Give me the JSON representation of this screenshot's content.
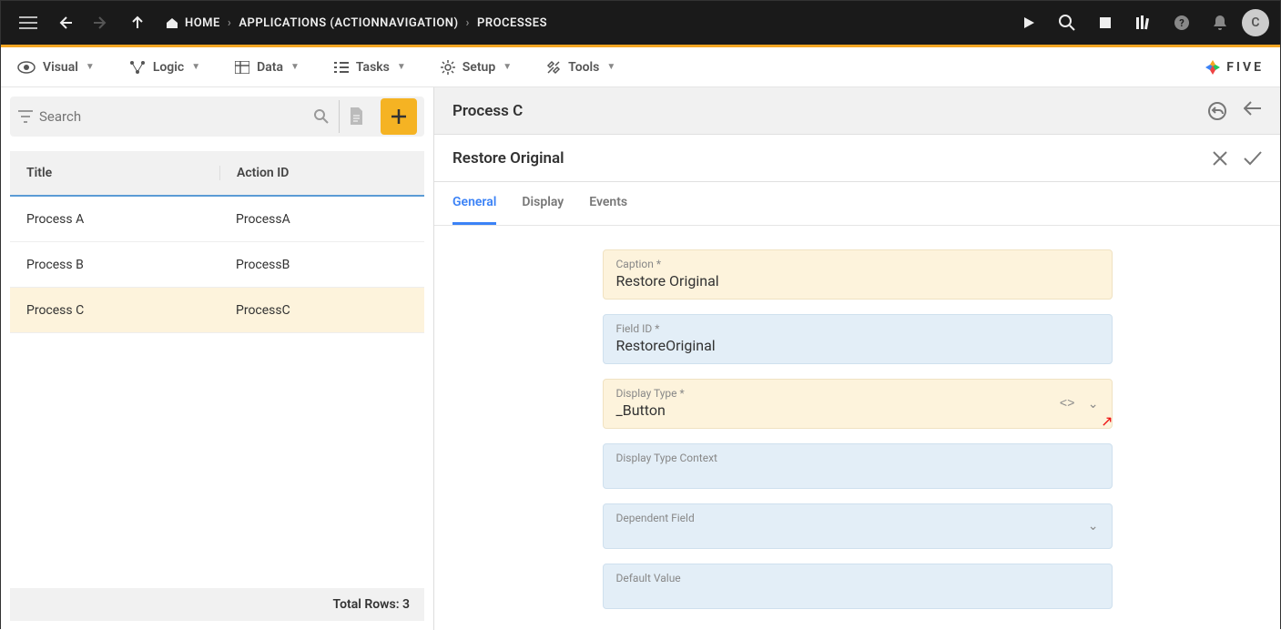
{
  "topbar": {
    "breadcrumb": [
      "HOME",
      "APPLICATIONS (ACTIONNAVIGATION)",
      "PROCESSES"
    ],
    "avatar_initial": "C"
  },
  "menubar": {
    "items": [
      "Visual",
      "Logic",
      "Data",
      "Tasks",
      "Setup",
      "Tools"
    ],
    "brand": "FIVE"
  },
  "left": {
    "search_placeholder": "Search",
    "columns": [
      "Title",
      "Action ID"
    ],
    "rows": [
      {
        "title": "Process A",
        "action_id": "ProcessA",
        "selected": false
      },
      {
        "title": "Process B",
        "action_id": "ProcessB",
        "selected": false
      },
      {
        "title": "Process C",
        "action_id": "ProcessC",
        "selected": true
      }
    ],
    "footer": "Total Rows: 3"
  },
  "right": {
    "crumb_title": "Process C",
    "sub_title": "Restore Original",
    "tabs": [
      "General",
      "Display",
      "Events"
    ],
    "active_tab": 0,
    "fields": {
      "caption": {
        "label": "Caption *",
        "value": "Restore Original"
      },
      "field_id": {
        "label": "Field ID *",
        "value": "RestoreOriginal"
      },
      "display_type": {
        "label": "Display Type *",
        "value": "_Button"
      },
      "display_type_context": {
        "label": "Display Type Context",
        "value": ""
      },
      "dependent_field": {
        "label": "Dependent Field",
        "value": ""
      },
      "default_value": {
        "label": "Default Value",
        "value": ""
      }
    }
  }
}
